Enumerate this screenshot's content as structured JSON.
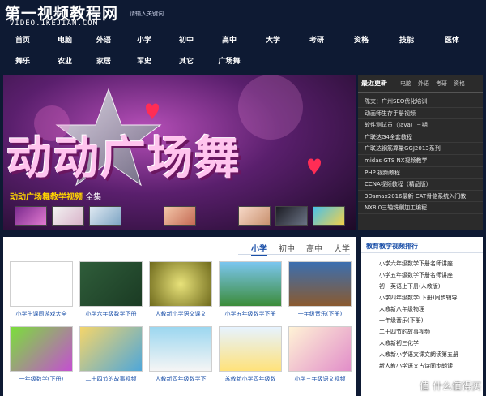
{
  "header": {
    "site_title": "第一视频教程网",
    "site_url": "VIDEO.1KEJIAN.COM",
    "note": "请输入关键词"
  },
  "nav": {
    "row1": [
      "首页",
      "电脑",
      "外语",
      "小学",
      "初中",
      "高中",
      "大学",
      "考研",
      "资格",
      "技能",
      "医体"
    ],
    "row2": [
      "舞乐",
      "农业",
      "家居",
      "军史",
      "其它",
      "广场舞"
    ]
  },
  "banner": {
    "title": "动动广场舞",
    "caption_highlight": "动动广场舞教学视频",
    "caption_rest": "全集"
  },
  "latest": {
    "title": "最近更新",
    "tabs": [
      "电脑",
      "外语",
      "考研",
      "资格"
    ],
    "items": [
      "陈文：广州SEO优化培训",
      "动画师生存手册视频",
      "软件测试员（Java）三期",
      "广联达G4全套教程",
      "广联达钢筋算量GGJ2013系列",
      "midas GTS NX视频教学",
      "PHP 视频教程",
      "CCNA视频教程（精品版）",
      "3Dsmax2016最新 CAT骨骼系统入门教",
      "NX8.0三轴铣削加工编程"
    ]
  },
  "main": {
    "tabs": [
      "小学",
      "初中",
      "高中",
      "大学"
    ],
    "active_tab": "小学",
    "cards": [
      "小学生课间游戏大全",
      "小学六年级数学下册",
      "人教新小学语文课文",
      "小学五年级数学下册",
      "一年级音乐(下册)",
      "一年级数学(下册)",
      "二十四节的故事视频",
      "人教新四年级数学下",
      "苏教新小学四年级数",
      "小学三年级语文视频"
    ]
  },
  "rank": {
    "title": "教育教学视频排行",
    "items": [
      "小学六年级数学下册名师讲座",
      "小学五年级数学下册名师讲座",
      "初一英语上下册(人教版)",
      "小学四年级数学(下册)同步辅导",
      "人教新八年级物理",
      "一年级音乐(下册)",
      "二十四节的故事视频",
      "人教新初三化学",
      "人教新小学语文课文朗读第五册",
      "新人教小学语文古诗同步朗读"
    ]
  },
  "watermark": "值 什么值得买",
  "colors": {
    "header_bg": "#0e1a33",
    "link_blue": "#1a4fa8",
    "panel_dark": "#2b2b2b",
    "highlight_yellow": "#ffd400"
  }
}
